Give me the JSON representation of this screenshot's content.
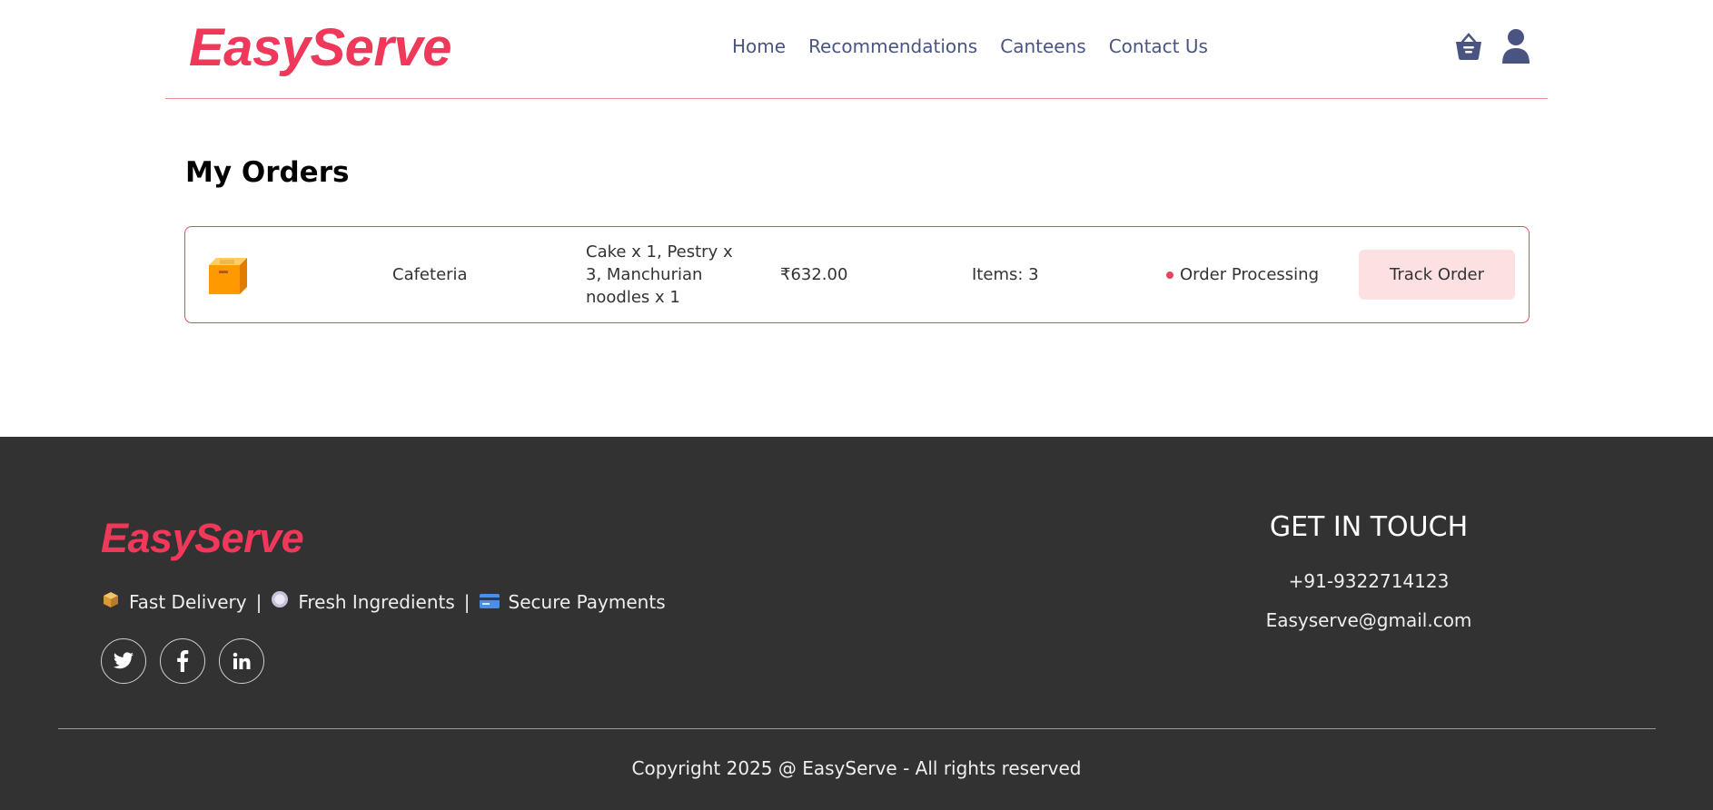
{
  "header": {
    "logo": "EasyServe",
    "nav": [
      "Home",
      "Recommendations",
      "Canteens",
      "Contact Us"
    ],
    "icons": [
      "basket-icon",
      "user-icon"
    ]
  },
  "main": {
    "title": "My Orders",
    "orders": [
      {
        "icon": "package-box-icon",
        "canteen": "Cafeteria",
        "items": "Cake x 1, Pestry x 3, Manchurian noodles x 1",
        "price": "₹632.00",
        "count": "Items: 3",
        "status": "Order Processing",
        "action": "Track Order"
      }
    ]
  },
  "footer": {
    "logo": "EasyServe",
    "features": [
      {
        "icon": "package-icon",
        "label": "Fast Delivery"
      },
      {
        "icon": "plate-icon",
        "label": "Fresh Ingredients"
      },
      {
        "icon": "credit-card-icon",
        "label": "Secure Payments"
      }
    ],
    "separator": "|",
    "social": [
      "twitter-icon",
      "facebook-icon",
      "linkedin-icon"
    ],
    "contact_title": "GET IN TOUCH",
    "phone": "+91-9322714123",
    "email": "Easyserve@gmail.com",
    "copyright": "Copyright 2025 @ EasyServe - All rights reserved"
  },
  "colors": {
    "brand": "#f0385a",
    "nav_text": "#4a5482",
    "card_border": "#e8455f",
    "button_bg": "#fde1e2",
    "footer_bg": "#323232"
  }
}
